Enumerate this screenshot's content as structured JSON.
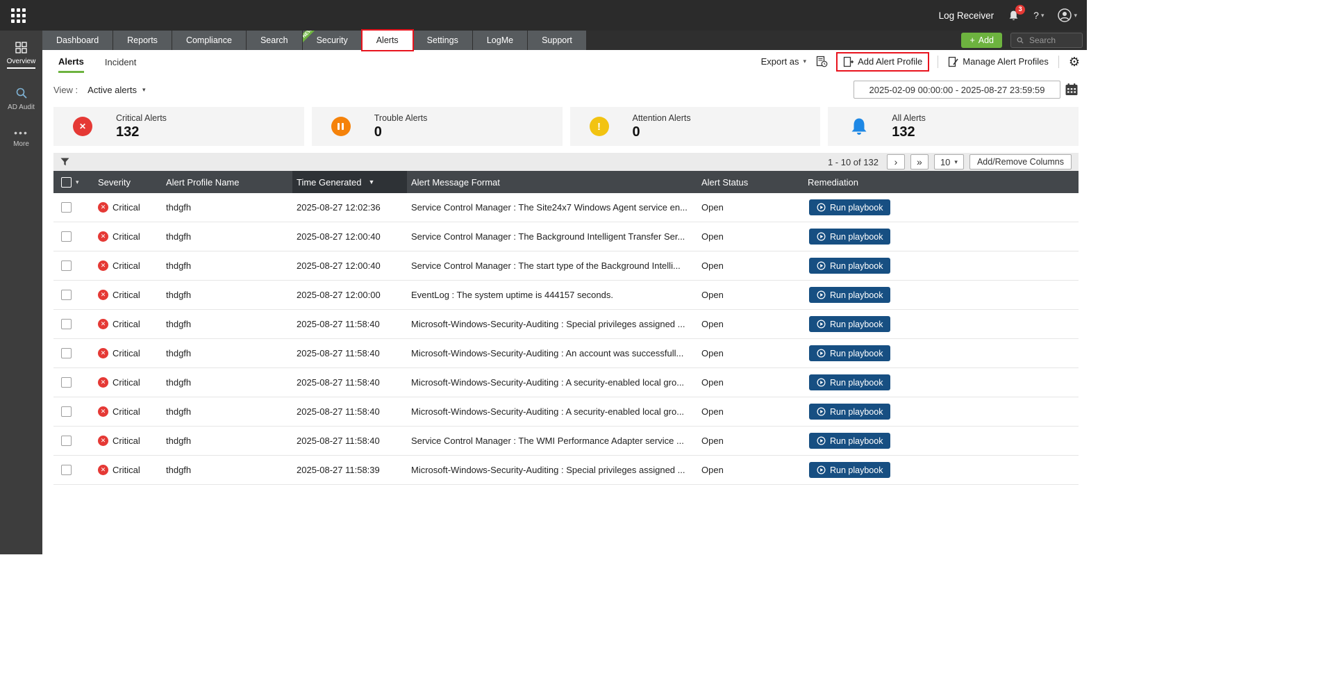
{
  "colors": {
    "accent_green": "#6db33f",
    "annotation_red": "#e8131d",
    "critical_red": "#e53935",
    "trouble_orange": "#f5820a",
    "attention_yellow": "#f2c311",
    "all_alerts_blue": "#1e88e5",
    "run_button_blue": "#174f82"
  },
  "topbar": {
    "product_name": "Log Receiver",
    "notification_count": "3",
    "help_label": "?"
  },
  "sidebar": {
    "items": [
      {
        "label": "Overview"
      },
      {
        "label": "AD Audit"
      },
      {
        "label": "More"
      }
    ]
  },
  "nav": {
    "tabs": [
      {
        "label": "Dashboard"
      },
      {
        "label": "Reports"
      },
      {
        "label": "Compliance"
      },
      {
        "label": "Search"
      },
      {
        "label": "Security"
      },
      {
        "label": "Alerts"
      },
      {
        "label": "Settings"
      },
      {
        "label": "LogMe"
      },
      {
        "label": "Support"
      }
    ],
    "new_badge": "NEW",
    "add_button_label": "Add",
    "search_placeholder": "Search"
  },
  "subnav": {
    "tab_alerts": "Alerts",
    "tab_incident": "Incident",
    "export_label": "Export as",
    "add_alert_profile_label": "Add Alert Profile",
    "manage_alert_profiles_label": "Manage Alert Profiles"
  },
  "filter_bar": {
    "view_label": "View :",
    "view_value": "Active alerts",
    "date_range": "2025-02-09 00:00:00 - 2025-08-27 23:59:59"
  },
  "summary_cards": [
    {
      "title": "Critical Alerts",
      "count": "132"
    },
    {
      "title": "Trouble Alerts",
      "count": "0"
    },
    {
      "title": "Attention Alerts",
      "count": "0"
    },
    {
      "title": "All Alerts",
      "count": "132"
    }
  ],
  "toolbar": {
    "pagination_text": "1 - 10 of 132",
    "next_label": "›",
    "last_label": "»",
    "page_size": "10",
    "add_remove_columns_label": "Add/Remove Columns"
  },
  "table": {
    "columns": [
      "Severity",
      "Alert Profile Name",
      "Time Generated",
      "Alert Message Format",
      "Alert Status",
      "Remediation"
    ],
    "run_playbook_label": "Run playbook",
    "rows": [
      {
        "severity": "Critical",
        "profile": "thdgfh",
        "time": "2025-08-27 12:02:36",
        "message": "Service Control Manager : The Site24x7 Windows Agent service en...",
        "status": "Open"
      },
      {
        "severity": "Critical",
        "profile": "thdgfh",
        "time": "2025-08-27 12:00:40",
        "message": "Service Control Manager : The Background Intelligent Transfer Ser...",
        "status": "Open"
      },
      {
        "severity": "Critical",
        "profile": "thdgfh",
        "time": "2025-08-27 12:00:40",
        "message": "Service Control Manager : The start type of the Background Intelli...",
        "status": "Open"
      },
      {
        "severity": "Critical",
        "profile": "thdgfh",
        "time": "2025-08-27 12:00:00",
        "message": "EventLog : The system uptime is 444157 seconds.",
        "status": "Open"
      },
      {
        "severity": "Critical",
        "profile": "thdgfh",
        "time": "2025-08-27 11:58:40",
        "message": "Microsoft-Windows-Security-Auditing : Special privileges assigned ...",
        "status": "Open"
      },
      {
        "severity": "Critical",
        "profile": "thdgfh",
        "time": "2025-08-27 11:58:40",
        "message": "Microsoft-Windows-Security-Auditing : An account was successfull...",
        "status": "Open"
      },
      {
        "severity": "Critical",
        "profile": "thdgfh",
        "time": "2025-08-27 11:58:40",
        "message": "Microsoft-Windows-Security-Auditing : A security-enabled local gro...",
        "status": "Open"
      },
      {
        "severity": "Critical",
        "profile": "thdgfh",
        "time": "2025-08-27 11:58:40",
        "message": "Microsoft-Windows-Security-Auditing : A security-enabled local gro...",
        "status": "Open"
      },
      {
        "severity": "Critical",
        "profile": "thdgfh",
        "time": "2025-08-27 11:58:40",
        "message": "Service Control Manager : The WMI Performance Adapter service ...",
        "status": "Open"
      },
      {
        "severity": "Critical",
        "profile": "thdgfh",
        "time": "2025-08-27 11:58:39",
        "message": "Microsoft-Windows-Security-Auditing : Special privileges assigned ...",
        "status": "Open"
      }
    ]
  }
}
